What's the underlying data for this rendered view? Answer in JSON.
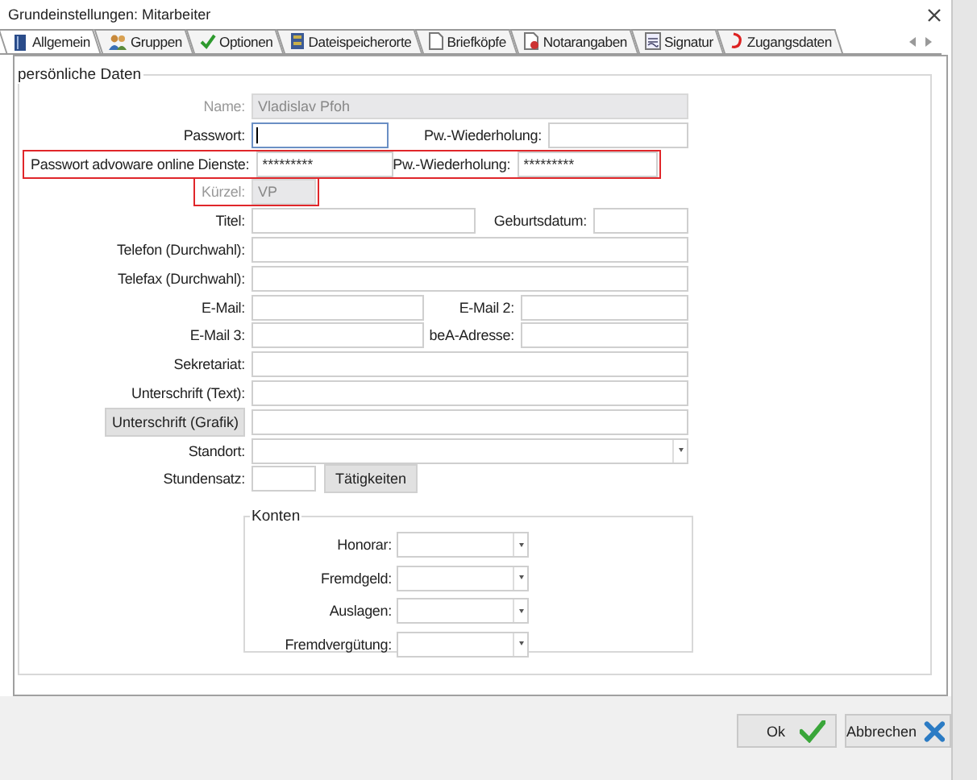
{
  "window": {
    "title": "Grundeinstellungen: Mitarbeiter"
  },
  "tabs": [
    {
      "label": "Allgemein",
      "selected": true
    },
    {
      "label": "Gruppen",
      "selected": false
    },
    {
      "label": "Optionen",
      "selected": false
    },
    {
      "label": "Dateispeicherorte",
      "selected": false
    },
    {
      "label": "Briefköpfe",
      "selected": false
    },
    {
      "label": "Notarangaben",
      "selected": false
    },
    {
      "label": "Signatur",
      "selected": false
    },
    {
      "label": "Zugangsdaten",
      "selected": false
    }
  ],
  "section": {
    "title": "persönliche Daten"
  },
  "rows": [
    {
      "highlighted": false,
      "fields": [
        {
          "label": "Name:",
          "kind": "text",
          "value": "Vladislav Pfoh",
          "disabled": true
        }
      ]
    },
    {
      "highlighted": false,
      "fields": [
        {
          "label": "Passwort:",
          "kind": "text",
          "focused": true,
          "disabled": false
        },
        {
          "label": "Pw.-Wiederholung:",
          "kind": "text",
          "disabled": false
        }
      ]
    },
    {
      "highlighted": true,
      "fields": [
        {
          "label": "Passwort advoware online Dienste:",
          "kind": "text",
          "value": "*********",
          "disabled": false
        },
        {
          "label": "Pw.-Wiederholung:",
          "kind": "text",
          "value": "*********",
          "disabled": false
        }
      ]
    },
    {
      "highlighted": true,
      "fields": [
        {
          "label": "Kürzel:",
          "kind": "text",
          "value": "VP",
          "disabled": true
        }
      ]
    },
    {
      "highlighted": false,
      "fields": [
        {
          "label": "Titel:",
          "kind": "text",
          "disabled": false
        },
        {
          "label": "Geburtsdatum:",
          "kind": "text",
          "disabled": false
        }
      ]
    },
    {
      "highlighted": false,
      "fields": [
        {
          "label": "Telefon (Durchwahl):",
          "kind": "text",
          "disabled": false
        }
      ]
    },
    {
      "highlighted": false,
      "fields": [
        {
          "label": "Telefax (Durchwahl):",
          "kind": "text",
          "disabled": false
        }
      ]
    },
    {
      "highlighted": false,
      "fields": [
        {
          "label": "E-Mail:",
          "kind": "text",
          "disabled": false
        },
        {
          "label": "E-Mail 2:",
          "kind": "text",
          "disabled": false
        }
      ]
    },
    {
      "highlighted": false,
      "fields": [
        {
          "label": "E-Mail 3:",
          "kind": "text",
          "disabled": false
        },
        {
          "label": "beA-Adresse:",
          "kind": "text",
          "disabled": false
        }
      ]
    },
    {
      "highlighted": false,
      "fields": [
        {
          "label": "Sekretariat:",
          "kind": "text",
          "disabled": false
        }
      ]
    },
    {
      "highlighted": false,
      "fields": [
        {
          "label": "Unterschrift (Text):",
          "kind": "text",
          "disabled": false
        }
      ]
    },
    {
      "highlighted": false,
      "fields": [
        {
          "label": "Unterschrift (Grafik)",
          "kind": "button-label",
          "disabled": false
        }
      ]
    },
    {
      "highlighted": false,
      "fields": [
        {
          "label": "Standort:",
          "kind": "combo",
          "disabled": false
        }
      ]
    },
    {
      "highlighted": false,
      "fields": [
        {
          "label": "Stundensatz:",
          "kind": "text",
          "disabled": false,
          "button": "Tätigkeiten"
        }
      ]
    }
  ],
  "accounts": {
    "title": "Konten",
    "rows": [
      {
        "label": "Honorar:"
      },
      {
        "label": "Fremdgeld:"
      },
      {
        "label": "Auslagen:"
      },
      {
        "label": "Fremdvergütung:"
      }
    ]
  },
  "buttons": [
    {
      "label": "Ok",
      "kind": "ok"
    },
    {
      "label": "Abbrechen",
      "kind": "cancel"
    }
  ]
}
